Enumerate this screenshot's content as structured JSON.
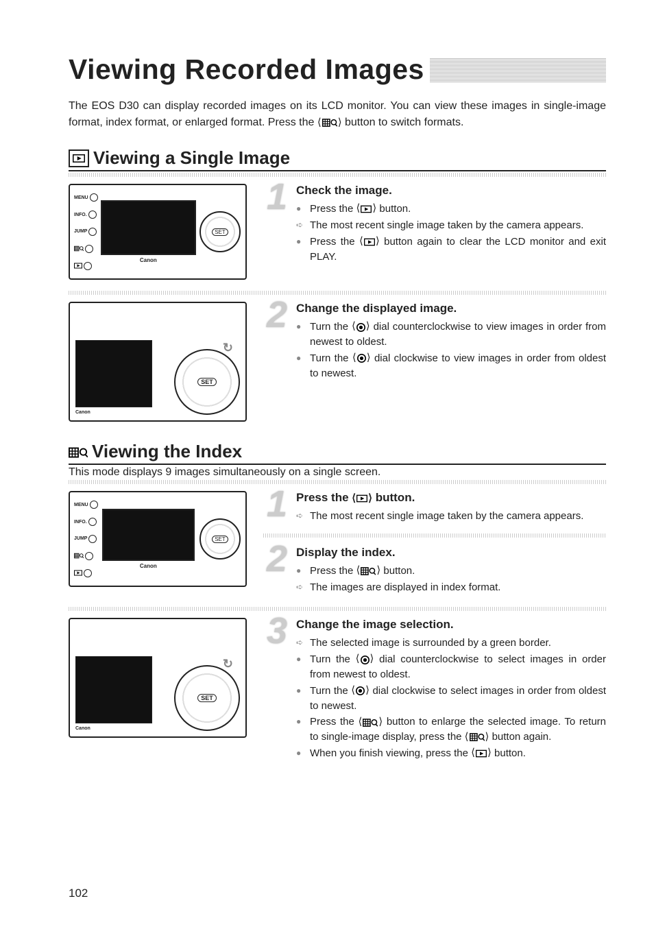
{
  "title": "Viewing Recorded Images",
  "intro_a": "The EOS D30 can display recorded images on its LCD monitor. You can view these images in single-image format, index format, or enlarged format. Press the ",
  "intro_b": " button to switch formats.",
  "section1": {
    "heading": "Viewing a Single Image",
    "step1": {
      "title": "Check the image.",
      "b1a": "Press the ",
      "b1b": " button.",
      "b2": "The most recent single image taken by the camera appears.",
      "b3a": "Press the ",
      "b3b": " button again to clear the LCD monitor and exit PLAY."
    },
    "step2": {
      "title": "Change the displayed image.",
      "b1a": "Turn the ",
      "b1b": " dial counterclockwise to view images in order from newest to oldest.",
      "b2a": "Turn the ",
      "b2b": " dial clockwise to view images in order from oldest to newest."
    }
  },
  "section2": {
    "heading": "Viewing the Index",
    "desc": "This mode displays 9 images simultaneously on a single screen.",
    "step1": {
      "titlea": "Press the ",
      "titleb": " button.",
      "b1": "The most recent single image taken by the camera appears."
    },
    "step2": {
      "title": "Display the index.",
      "b1a": "Press the ",
      "b1b": " button.",
      "b2": "The images are displayed in index format."
    },
    "step3": {
      "title": "Change the image selection.",
      "b1": "The selected image is surrounded by a green border.",
      "b2a": "Turn the ",
      "b2b": " dial counterclockwise to select images in order from newest to oldest.",
      "b3a": "Turn the ",
      "b3b": " dial clockwise to select images in order from oldest to newest.",
      "b4a": "Press the ",
      "b4b": " button to enlarge the selected image. To return to single-image display, press the ",
      "b4c": " button again.",
      "b5a": "When you finish viewing, press the ",
      "b5b": " button."
    }
  },
  "cam": {
    "labels": [
      "MENU",
      "INFO.",
      "JUMP"
    ],
    "brand": "Canon",
    "set": "SET"
  },
  "page_number": "102"
}
